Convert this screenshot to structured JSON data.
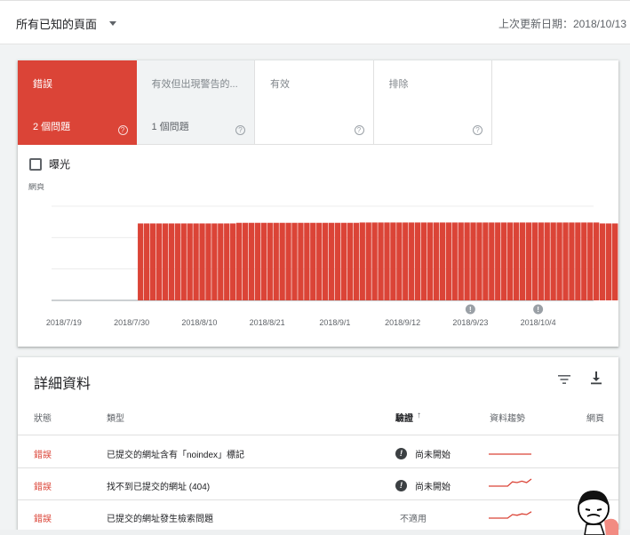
{
  "topbar": {
    "filter_label": "所有已知的頁面",
    "last_updated": "上次更新日期：2018/10/13"
  },
  "tiles": [
    {
      "label": "錯誤",
      "count": "2 個問題"
    },
    {
      "label": "有效但出現警告的...",
      "count": "1 個問題"
    },
    {
      "label": "有效",
      "count": ""
    },
    {
      "label": "排除",
      "count": ""
    }
  ],
  "help_glyph": "?",
  "exposure_label": "曝光",
  "chart_data": {
    "type": "bar",
    "ylabel": "網頁",
    "bar_color": "#db4437",
    "x_tick_labels": [
      "2018/7/19",
      "2018/7/30",
      "2018/8/10",
      "2018/8/21",
      "2018/9/1",
      "2018/9/12",
      "2018/9/23",
      "2018/10/4"
    ],
    "x_start": "2018/7/17",
    "x_end": "2018/10/13",
    "bars_start": "2018/7/31",
    "annotation_dates": [
      "2018/9/23",
      "2018/10/4"
    ],
    "annotation_glyph": "!",
    "series": [
      {
        "values": [
          2.45,
          2.45,
          2.45,
          2.45,
          2.45,
          2.45,
          2.45,
          2.45,
          2.45,
          2.45,
          2.45,
          2.45,
          2.45,
          2.45,
          2.45,
          2.45,
          2.47,
          2.47,
          2.47,
          2.47,
          2.47,
          2.47,
          2.47,
          2.47,
          2.47,
          2.47,
          2.47,
          2.47,
          2.47,
          2.47,
          2.47,
          2.47,
          2.47,
          2.47,
          2.47,
          2.47,
          2.48,
          2.48,
          2.48,
          2.48,
          2.48,
          2.48,
          2.48,
          2.48,
          2.48,
          2.48,
          2.48,
          2.48,
          2.48,
          2.48,
          2.48,
          2.48,
          2.48,
          2.48,
          2.48,
          2.48,
          2.48,
          2.48,
          2.48,
          2.48,
          2.48,
          2.48,
          2.48,
          2.48,
          2.48,
          2.48,
          2.48,
          2.48,
          2.48,
          2.48,
          2.48,
          2.48,
          2.48,
          2.48,
          2.48,
          2.45,
          2.45,
          2.45,
          2.45,
          2.45,
          2.45,
          2.45,
          2.45,
          2.45,
          2.45,
          2.05,
          2.05
        ]
      }
    ]
  },
  "details": {
    "title": "詳細資料",
    "columns": {
      "status": "狀態",
      "type": "類型",
      "validation": "驗證",
      "sort_arrow": "↑",
      "trend": "資料趨勢",
      "pages": "網頁"
    },
    "rows": [
      {
        "status": "錯誤",
        "type": "已提交的網址含有「noindex」標記",
        "validation": "尚未開始",
        "has_alert": true,
        "trend": [
          1,
          1,
          1,
          1,
          1,
          1,
          1,
          1,
          1,
          1
        ]
      },
      {
        "status": "錯誤",
        "type": "找不到已提交的網址 (404)",
        "validation": "尚未開始",
        "has_alert": true,
        "trend": [
          1,
          1,
          1,
          1,
          1,
          1.12,
          1.1,
          1.14,
          1.1,
          1.2
        ]
      },
      {
        "status": "錯誤",
        "type": "已提交的網址發生檢索問題",
        "validation": "不適用",
        "has_alert": false,
        "trend": [
          1,
          1,
          1,
          1,
          1,
          1.1,
          1.08,
          1.12,
          1.1,
          1.18
        ]
      }
    ],
    "alert_glyph": "!"
  },
  "colors": {
    "error_red": "#db4437",
    "warning_bg": "#f1f3f4",
    "text_primary": "#202124",
    "text_secondary": "#5f6368"
  },
  "icons": [
    "caret-down-icon",
    "help-icon",
    "checkbox-icon",
    "filter-icon",
    "download-icon",
    "alert-icon",
    "mascot-image"
  ]
}
